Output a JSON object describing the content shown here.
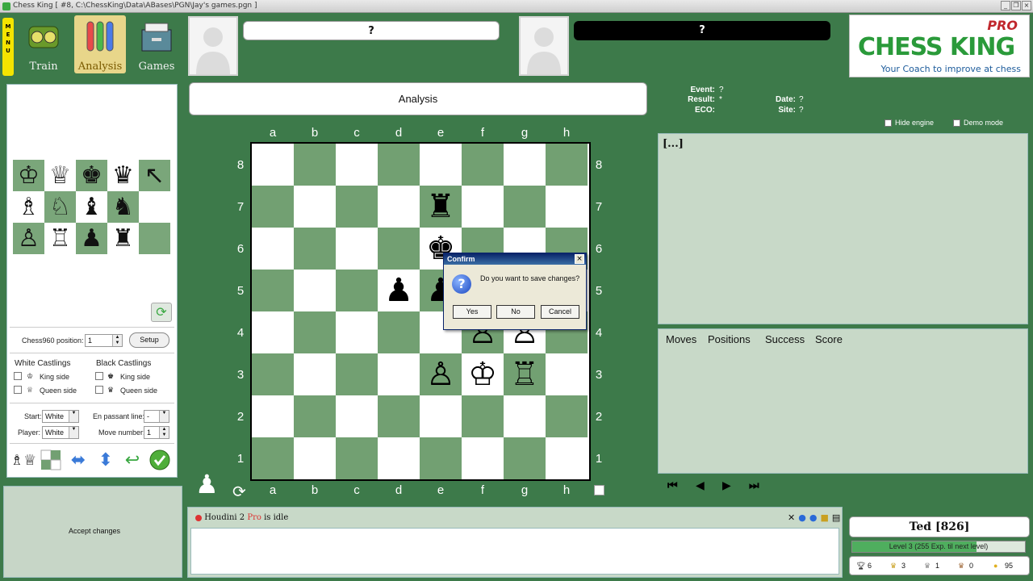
{
  "window": {
    "title": "Chess King [ #8, C:\\ChessKing\\Data\\ABases\\PGN\\Jay's games.pgn ]"
  },
  "menu": {
    "label": "MENU"
  },
  "nav": {
    "train": "Train",
    "analysis": "Analysis",
    "games": "Games"
  },
  "players": {
    "white_name": "?",
    "black_name": "?"
  },
  "logo": {
    "brand": "CHESS KING",
    "pro": "PRO",
    "tagline": "Your Coach to improve at chess"
  },
  "board": {
    "title": "Analysis",
    "files": [
      "a",
      "b",
      "c",
      "d",
      "e",
      "f",
      "g",
      "h"
    ],
    "ranks": [
      "8",
      "7",
      "6",
      "5",
      "4",
      "3",
      "2",
      "1"
    ],
    "pieces": {
      "e7": "♜",
      "e6": "♚",
      "d5": "♟",
      "e5": "♟",
      "f4": "♙",
      "g4": "♙",
      "e3": "♙",
      "f3": "♔",
      "g3": "♖"
    },
    "side_to_move_icon": "white-pawn-icon"
  },
  "setup": {
    "palette": [
      "♔",
      "♕",
      "♚",
      "♛",
      "↖",
      "♗",
      "♘",
      "♝",
      "♞",
      "",
      "♙",
      "♖",
      "♟",
      "♜",
      ""
    ],
    "chess960_label": "Chess960 position:",
    "chess960_value": "1",
    "setup_button": "Setup",
    "white_castlings": "White Castlings",
    "black_castlings": "Black Castlings",
    "king_side": "King side",
    "queen_side": "Queen side",
    "start_label": "Start:",
    "start_value": "White",
    "player_label": "Player:",
    "player_value": "White",
    "en_passant_label": "En passant line:",
    "en_passant_value": "-",
    "move_number_label": "Move number:",
    "move_number_value": "1"
  },
  "accept": {
    "label": "Accept changes"
  },
  "dialog": {
    "title": "Confirm",
    "message": "Do you want to save changes?",
    "yes": "Yes",
    "no": "No",
    "cancel": "Cancel"
  },
  "game_header": {
    "event_label": "Event:",
    "event": "?",
    "result_label": "Result:",
    "result": "*",
    "eco_label": "ECO:",
    "eco": "",
    "date_label": "Date:",
    "date": "?",
    "site_label": "Site:",
    "site": "?",
    "hide_engine": "Hide engine",
    "demo_mode": "Demo mode"
  },
  "notation": {
    "text": "[...]"
  },
  "tree": {
    "headers": [
      "Moves",
      "Positions",
      "Success",
      "Score"
    ]
  },
  "engine": {
    "name": "Houdini 2",
    "pro": "Pro",
    "status": "is idle"
  },
  "user": {
    "name": "Ted [826]",
    "level_text": "Level 3 (255 Exp. til next level)",
    "level_progress": 0.72,
    "stats": [
      "6",
      "3",
      "1",
      "0",
      "95"
    ]
  }
}
